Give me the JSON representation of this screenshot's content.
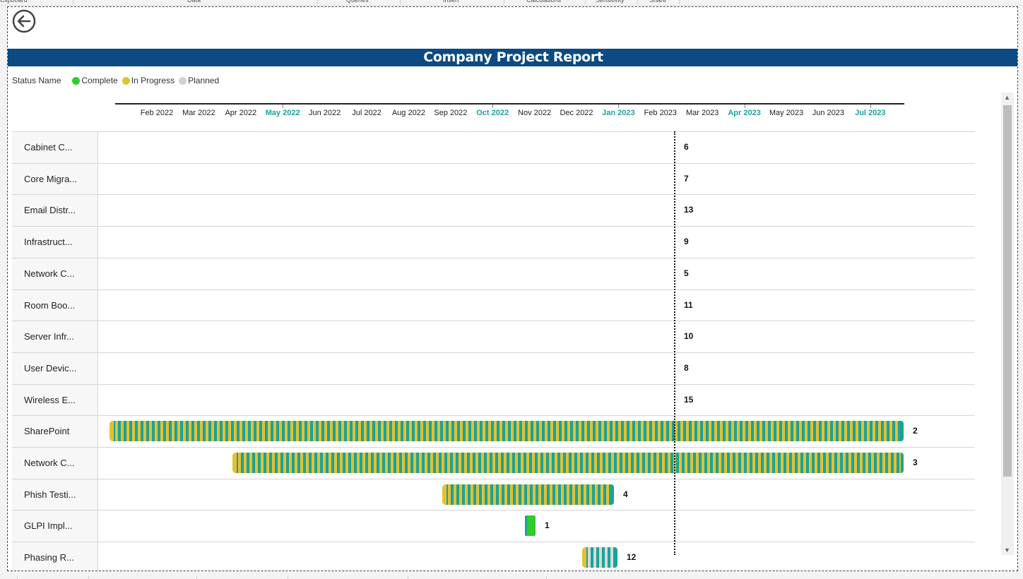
{
  "ribbon": {
    "groups": [
      "Clipboard",
      "Data",
      "Queries",
      "Insert",
      "Calculations",
      "Sensitivity",
      "Share"
    ]
  },
  "back_button": {
    "icon": "arrow-left-circle-icon"
  },
  "report": {
    "title": "Company Project Report"
  },
  "legend": {
    "title": "Status Name",
    "items": [
      {
        "label": "Complete",
        "color": "#2ecc2e"
      },
      {
        "label": "In Progress",
        "color": "#e3c133"
      },
      {
        "label": "Planned",
        "color": "#d0d0d0"
      }
    ]
  },
  "timeline": {
    "months": [
      "Feb 2022",
      "Mar 2022",
      "Apr 2022",
      "May 2022",
      "Jun 2022",
      "Jul 2022",
      "Aug 2022",
      "Sep 2022",
      "Oct 2022",
      "Nov 2022",
      "Dec 2022",
      "Jan 2023",
      "Feb 2023",
      "Mar 2023",
      "Apr 2023",
      "May 2023",
      "Jun 2023",
      "Jul 2023"
    ],
    "highlighted_months": [
      "May 2022",
      "Oct 2022",
      "Jan 2023",
      "Apr 2023",
      "Jul 2023"
    ]
  },
  "rows": [
    {
      "label": "Cabinet C...",
      "number": "6"
    },
    {
      "label": "Core Migra...",
      "number": "7"
    },
    {
      "label": "Email Distr...",
      "number": "13"
    },
    {
      "label": "Infrastruct...",
      "number": "9"
    },
    {
      "label": "Network C...",
      "number": "5"
    },
    {
      "label": "Room Boo...",
      "number": "11"
    },
    {
      "label": "Server Infr...",
      "number": "10"
    },
    {
      "label": "User Devic...",
      "number": "8"
    },
    {
      "label": "Wireless E...",
      "number": "15"
    },
    {
      "label": "SharePoint",
      "number": "2",
      "status": "In Progress",
      "start": "Jan 2022",
      "end": "Jul 2023"
    },
    {
      "label": "Network C...",
      "number": "3",
      "status": "In Progress",
      "start": "Apr 2022",
      "end": "Jul 2023"
    },
    {
      "label": "Phish Testi...",
      "number": "4",
      "status": "In Progress",
      "start": "Sep 2022",
      "end": "Dec 2022"
    },
    {
      "label": "GLPI Impl...",
      "number": "1",
      "status": "Complete",
      "start": "Nov 2022",
      "end": "Nov 2022"
    },
    {
      "label": "Phasing R...",
      "number": "12",
      "status": "Planned",
      "start": "Dec 2022",
      "end": "Jan 2023"
    }
  ],
  "colors": {
    "title_bar": "#0b4a82",
    "accent": "#1aa39a"
  }
}
